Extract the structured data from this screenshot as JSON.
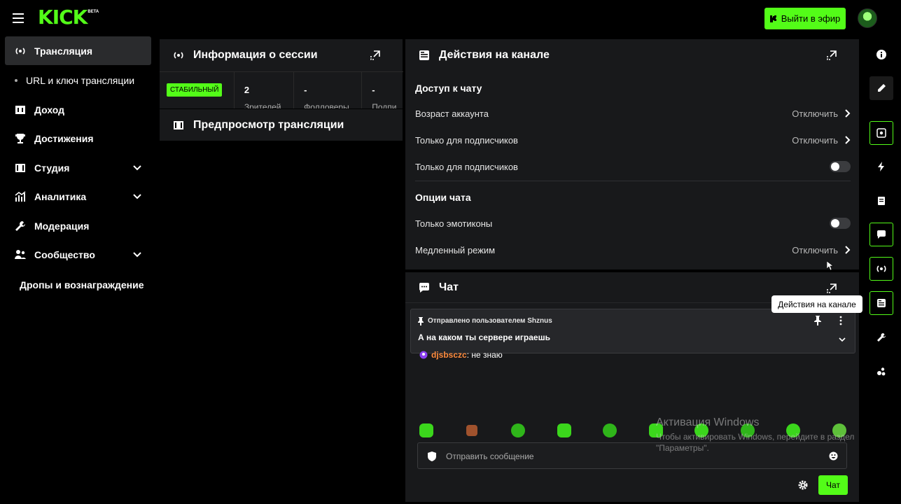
{
  "topbar": {
    "logo": "KICK",
    "logo_badge": "BETA",
    "go_live_label": "Выйти в эфир"
  },
  "sidebar": {
    "items": [
      {
        "label": "Трансляция",
        "icon": "broadcast-icon",
        "active": true
      },
      {
        "label": "URL и ключ трансляции",
        "sub": true
      },
      {
        "label": "Доход",
        "icon": "dollar-icon"
      },
      {
        "label": "Достижения",
        "icon": "trophy-icon"
      },
      {
        "label": "Студия",
        "icon": "studio-icon",
        "expandable": true
      },
      {
        "label": "Аналитика",
        "icon": "chart-icon",
        "expandable": true
      },
      {
        "label": "Модерация",
        "icon": "wrench-icon"
      },
      {
        "label": "Сообщество",
        "icon": "users-icon",
        "expandable": true
      },
      {
        "label": "Дропы и вознаграждение",
        "sub": true
      }
    ]
  },
  "session": {
    "title": "Информация о сессии",
    "badge": "СТАБИЛЬНЫЙ",
    "stats": [
      {
        "value": "2",
        "label": "Зрителей"
      },
      {
        "value": "-",
        "label": "Фолловеры"
      },
      {
        "value": "-",
        "label": "Подпи"
      }
    ]
  },
  "preview": {
    "title": "Предпросмотр трансляции"
  },
  "actions": {
    "title": "Действия на канале",
    "chat_access_title": "Доступ к чату",
    "account_age_label": "Возраст аккаунта",
    "account_age_value": "Отключить",
    "subs_only_label": "Только для подписчиков",
    "subs_only_value": "Отключить",
    "subs_only_toggle_label": "Только для подписчиков",
    "chat_options_title": "Опции чата",
    "emotes_only_label": "Только эмотиконы",
    "slow_mode_label": "Медленный режим",
    "slow_mode_value": "Отключить"
  },
  "chat": {
    "title": "Чат",
    "pinned_by": "Отправлено пользователем Shznus",
    "pinned_message": "А на каком ты сервере играешь",
    "message_user": "djsbsczc",
    "message_text": ": не знаю",
    "input_placeholder": "Отправить сообщение",
    "send_label": "Чат"
  },
  "rail": {
    "tooltip": "Действия на канале"
  },
  "watermark": {
    "title": "Активация Windows",
    "line1": "Чтобы активировать Windows, перейдите в раздел",
    "line2": "\"Параметры\"."
  },
  "colors": {
    "accent": "#53fc18",
    "panel": "#18191b",
    "background": "#000000"
  }
}
